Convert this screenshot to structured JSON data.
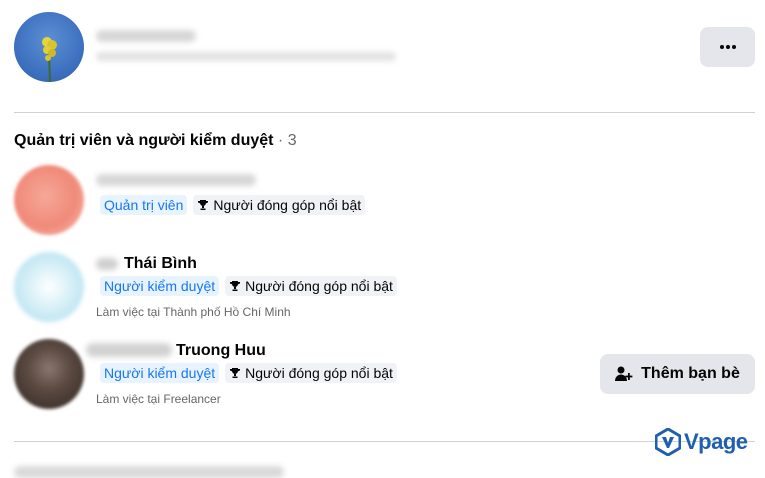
{
  "profile": {
    "more_icon": "more-horizontal-icon"
  },
  "admins_section": {
    "title": "Quản trị viên và người kiểm duyệt",
    "separator": "·",
    "count": "3"
  },
  "members": [
    {
      "name": "",
      "role_badge": "Quản trị viên",
      "contributor_badge": "Người đóng góp nổi bật",
      "subtitle": "",
      "avatar_color": "#f08a7a"
    },
    {
      "name": "Thái Bình",
      "role_badge": "Người kiểm duyệt",
      "contributor_badge": "Người đóng góp nổi bật",
      "subtitle": "Làm việc tại Thành phố Hồ Chí Minh",
      "avatar_color": "#bfe6f3"
    },
    {
      "name": "Truong Huu",
      "role_badge": "Người kiểm duyệt",
      "contributor_badge": "Người đóng góp nổi bật",
      "subtitle": "Làm việc tại Freelancer",
      "avatar_color": "#4a3a33"
    }
  ],
  "add_friend_button": {
    "label": "Thêm bạn bè",
    "icon": "add-friend-icon"
  },
  "watermark": {
    "text": "Vpage"
  },
  "colors": {
    "badge_blue": "#1877f2",
    "button_gray": "#e4e6eb",
    "secondary_text": "#65676b"
  }
}
